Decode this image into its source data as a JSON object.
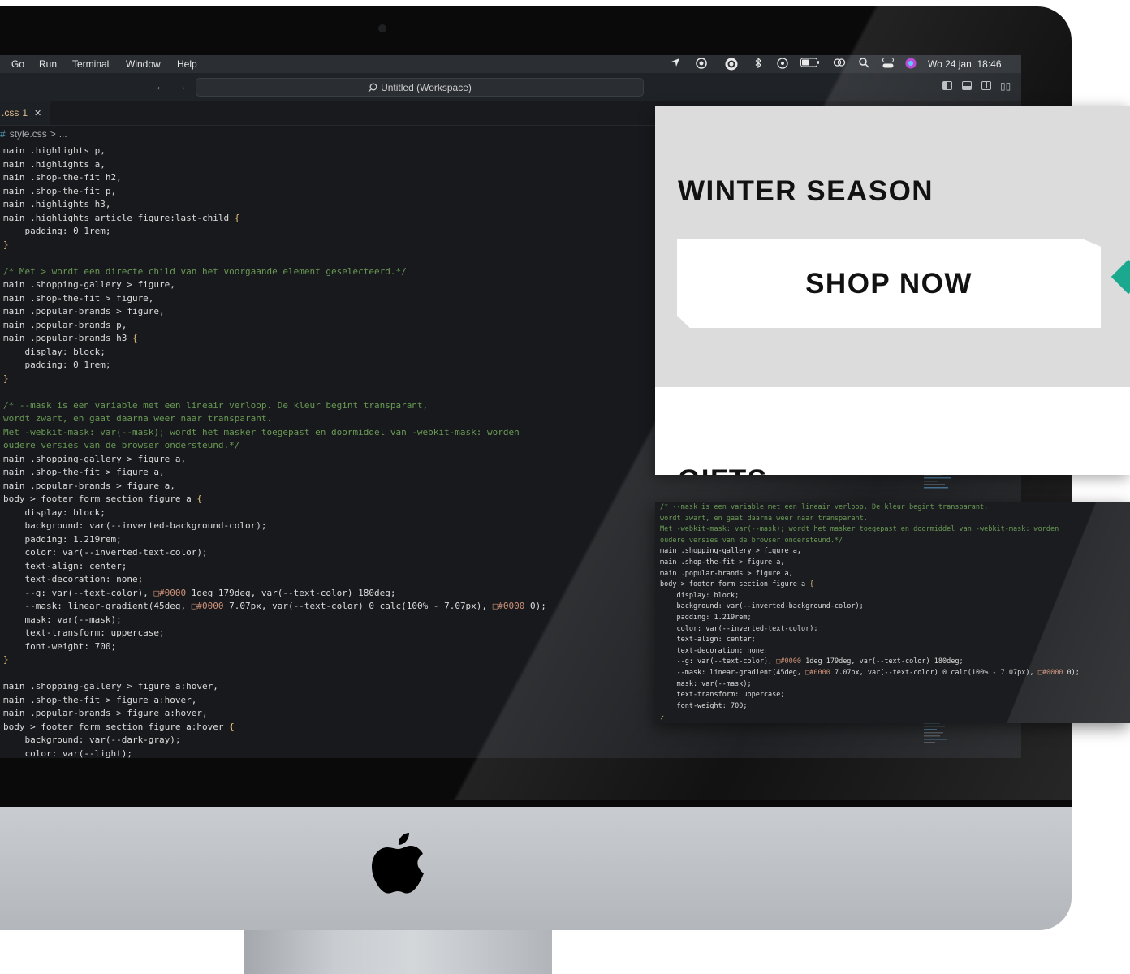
{
  "menubar": {
    "menus": [
      "Go",
      "Run",
      "Terminal",
      "Window",
      "Help"
    ],
    "clock": "Wo 24 jan.  18:46",
    "status_icons": [
      "location-arrow-icon",
      "cloud-sync-icon",
      "creative-cloud-icon",
      "bluetooth-icon",
      "play-circle-icon",
      "battery-icon",
      "link-icon",
      "search-icon",
      "control-center-icon",
      "siri-icon"
    ]
  },
  "titlebar": {
    "search_text": "Untitled (Workspace)",
    "back": "←",
    "forward": "→"
  },
  "tab": {
    "label": ".css",
    "modified": "1",
    "close": "✕"
  },
  "breadcrumb": {
    "icon": "#",
    "file": "style.css",
    "sep": ">",
    "rest": "..."
  },
  "editor": {
    "lines": [
      [
        {
          "t": "main .highlights p,",
          "c": "#dcdcdc"
        }
      ],
      [
        {
          "t": "main .highlights a,",
          "c": "#dcdcdc"
        }
      ],
      [
        {
          "t": "main .shop-the-fit h2,",
          "c": "#dcdcdc"
        }
      ],
      [
        {
          "t": "main .shop-the-fit p,",
          "c": "#dcdcdc"
        }
      ],
      [
        {
          "t": "main .highlights h3,",
          "c": "#dcdcdc"
        }
      ],
      [
        {
          "t": "main .highlights article figure:last-child ",
          "c": "#dcdcdc"
        },
        {
          "t": "{",
          "c": "#e5c07b"
        }
      ],
      [
        {
          "t": "    padding",
          "c": "#dcdcdc"
        },
        {
          "t": ": 0 1rem;",
          "c": "#dcdcdc"
        }
      ],
      [
        {
          "t": "}",
          "c": "#e5c07b"
        }
      ],
      [
        {
          "t": "",
          "c": "#dcdcdc"
        }
      ],
      [
        {
          "t": "/* Met > wordt een directe child van het voorgaande element geselecteerd.*/",
          "c": "#6a9955"
        }
      ],
      [
        {
          "t": "main .shopping-gallery > figure,",
          "c": "#dcdcdc"
        }
      ],
      [
        {
          "t": "main .shop-the-fit > figure,",
          "c": "#dcdcdc"
        }
      ],
      [
        {
          "t": "main .popular-brands > figure,",
          "c": "#dcdcdc"
        }
      ],
      [
        {
          "t": "main .popular-brands p,",
          "c": "#dcdcdc"
        }
      ],
      [
        {
          "t": "main .popular-brands h3 ",
          "c": "#dcdcdc"
        },
        {
          "t": "{",
          "c": "#e5c07b"
        }
      ],
      [
        {
          "t": "    display: block;",
          "c": "#dcdcdc"
        }
      ],
      [
        {
          "t": "    padding: 0 1rem;",
          "c": "#dcdcdc"
        }
      ],
      [
        {
          "t": "}",
          "c": "#e5c07b"
        }
      ],
      [
        {
          "t": "",
          "c": "#dcdcdc"
        }
      ],
      [
        {
          "t": "/* --mask is een variable met een lineair verloop. De kleur begint transparant,",
          "c": "#6a9955"
        }
      ],
      [
        {
          "t": "wordt zwart, en gaat daarna weer naar transparant.",
          "c": "#6a9955"
        }
      ],
      [
        {
          "t": "Met -webkit-mask: var(--mask); wordt het masker toegepast en doormiddel van -webkit-mask: worden",
          "c": "#6a9955"
        }
      ],
      [
        {
          "t": "oudere versies van de browser ondersteund.*/",
          "c": "#6a9955"
        }
      ],
      [
        {
          "t": "main .shopping-gallery > figure a,",
          "c": "#dcdcdc"
        }
      ],
      [
        {
          "t": "main .shop-the-fit > figure a,",
          "c": "#dcdcdc"
        }
      ],
      [
        {
          "t": "main .popular-brands > figure a,",
          "c": "#dcdcdc"
        }
      ],
      [
        {
          "t": "body > footer form section figure a ",
          "c": "#dcdcdc"
        },
        {
          "t": "{",
          "c": "#e5c07b"
        }
      ],
      [
        {
          "t": "    display: block;",
          "c": "#dcdcdc"
        }
      ],
      [
        {
          "t": "    background: var(--inverted-background-color);",
          "c": "#dcdcdc"
        }
      ],
      [
        {
          "t": "    padding: 1.219rem;",
          "c": "#dcdcdc"
        }
      ],
      [
        {
          "t": "    color: var(--inverted-text-color);",
          "c": "#dcdcdc"
        }
      ],
      [
        {
          "t": "    text-align: center;",
          "c": "#dcdcdc"
        }
      ],
      [
        {
          "t": "    text-decoration: none;",
          "c": "#dcdcdc"
        }
      ],
      [
        {
          "t": "    --g: var(--text-color), ",
          "c": "#dcdcdc"
        },
        {
          "t": "□#0000",
          "c": "#ce9178"
        },
        {
          "t": " 1deg 179deg, var(--text-color) 180deg;",
          "c": "#dcdcdc"
        }
      ],
      [
        {
          "t": "    --mask: linear-gradient(45deg, ",
          "c": "#dcdcdc"
        },
        {
          "t": "□#0000",
          "c": "#ce9178"
        },
        {
          "t": " 7.07px, var(--text-color) 0 calc(100% - 7.07px), ",
          "c": "#dcdcdc"
        },
        {
          "t": "□#0000",
          "c": "#ce9178"
        },
        {
          "t": " 0);",
          "c": "#dcdcdc"
        }
      ],
      [
        {
          "t": "    mask: var(--mask);",
          "c": "#dcdcdc"
        }
      ],
      [
        {
          "t": "    text-transform: uppercase;",
          "c": "#dcdcdc"
        }
      ],
      [
        {
          "t": "    font-weight: 700;",
          "c": "#dcdcdc"
        }
      ],
      [
        {
          "t": "}",
          "c": "#e5c07b"
        }
      ],
      [
        {
          "t": "",
          "c": "#dcdcdc"
        }
      ],
      [
        {
          "t": "main .shopping-gallery > figure a:hover,",
          "c": "#dcdcdc"
        }
      ],
      [
        {
          "t": "main .shop-the-fit > figure a:hover,",
          "c": "#dcdcdc"
        }
      ],
      [
        {
          "t": "main .popular-brands > figure a:hover,",
          "c": "#dcdcdc"
        }
      ],
      [
        {
          "t": "body > footer form section figure a:hover ",
          "c": "#dcdcdc"
        },
        {
          "t": "{",
          "c": "#e5c07b"
        }
      ],
      [
        {
          "t": "    background: var(--dark-gray);",
          "c": "#dcdcdc"
        }
      ],
      [
        {
          "t": "    color: var(--light);",
          "c": "#dcdcdc"
        }
      ]
    ]
  },
  "zoom_code": {
    "lines": [
      [
        {
          "t": "/* --mask is een variable met een lineair verloop. De kleur begint transparant,",
          "c": "#6a9955"
        }
      ],
      [
        {
          "t": "wordt zwart, en gaat daarna weer naar transparant.",
          "c": "#6a9955"
        }
      ],
      [
        {
          "t": "Met -webkit-mask: var(--mask); wordt het masker toegepast en doormiddel van -webkit-mask: worden",
          "c": "#6a9955"
        }
      ],
      [
        {
          "t": "oudere versies van de browser ondersteund.*/",
          "c": "#6a9955"
        }
      ],
      [
        {
          "t": "main .shopping-gallery > figure a,",
          "c": "#dcdcdc"
        }
      ],
      [
        {
          "t": "main .shop-the-fit > figure a,",
          "c": "#dcdcdc"
        }
      ],
      [
        {
          "t": "main .popular-brands > figure a,",
          "c": "#dcdcdc"
        }
      ],
      [
        {
          "t": "body > footer form section figure a ",
          "c": "#dcdcdc"
        },
        {
          "t": "{",
          "c": "#e5c07b"
        }
      ],
      [
        {
          "t": "    display: block;",
          "c": "#dcdcdc"
        }
      ],
      [
        {
          "t": "    background: var(--inverted-background-color);",
          "c": "#dcdcdc"
        }
      ],
      [
        {
          "t": "    padding: 1.219rem;",
          "c": "#dcdcdc"
        }
      ],
      [
        {
          "t": "    color: var(--inverted-text-color);",
          "c": "#dcdcdc"
        }
      ],
      [
        {
          "t": "    text-align: center;",
          "c": "#dcdcdc"
        }
      ],
      [
        {
          "t": "    text-decoration: none;",
          "c": "#dcdcdc"
        }
      ],
      [
        {
          "t": "    --g: var(--text-color), ",
          "c": "#dcdcdc"
        },
        {
          "t": "□#0000",
          "c": "#ce9178"
        },
        {
          "t": " 1deg 179deg, var(--text-color) 180deg;",
          "c": "#dcdcdc"
        }
      ],
      [
        {
          "t": "    --mask: linear-gradient(45deg, ",
          "c": "#dcdcdc"
        },
        {
          "t": "□#0000",
          "c": "#ce9178"
        },
        {
          "t": " 7.07px, var(--text-color) 0 calc(100% - 7.07px), ",
          "c": "#dcdcdc"
        },
        {
          "t": "□#0000",
          "c": "#ce9178"
        },
        {
          "t": " 0);",
          "c": "#dcdcdc"
        }
      ],
      [
        {
          "t": "    mask: var(--mask);",
          "c": "#dcdcdc"
        }
      ],
      [
        {
          "t": "    text-transform: uppercase;",
          "c": "#dcdcdc"
        }
      ],
      [
        {
          "t": "    font-weight: 700;",
          "c": "#dcdcdc"
        }
      ],
      [
        {
          "t": "}",
          "c": "#e5c07b"
        }
      ]
    ]
  },
  "preview": {
    "title": "WINTER SEASON",
    "button": "SHOP NOW",
    "next_heading": "GIFTS"
  },
  "colors": {
    "accent_teal": "#1aa88f",
    "comment": "#6a9955",
    "brace": "#e5c07b"
  }
}
